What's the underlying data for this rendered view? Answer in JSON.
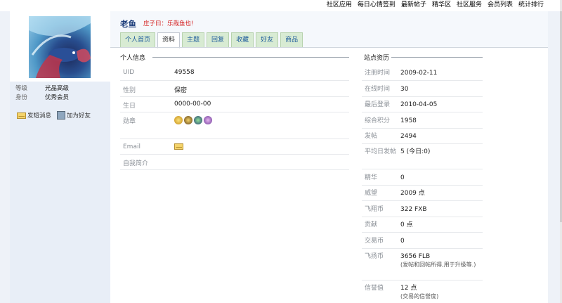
{
  "topnav": [
    "社区应用",
    "每日心情签到",
    "最新帖子",
    "精华区",
    "社区服务",
    "会员列表",
    "统计排行"
  ],
  "sidebar": {
    "info": [
      {
        "label": "等级",
        "value": "光晶高级"
      },
      {
        "label": "身份",
        "value": "优秀会员"
      }
    ],
    "actions": [
      {
        "icon": "mail-icon",
        "label": "发短消息"
      },
      {
        "icon": "user-add-icon",
        "label": "加为好友"
      }
    ]
  },
  "profile": {
    "username": "老鱼",
    "motto": "庄子曰：乐哉鱼也!",
    "tabs": [
      "个人首页",
      "资料",
      "主题",
      "回复",
      "收藏",
      "好友",
      "商品"
    ],
    "active_tab": "资料"
  },
  "personal": {
    "title": "个人信息",
    "uid_label": "UID",
    "uid": "49558",
    "gender_label": "性别",
    "gender": "保密",
    "birthday_label": "生日",
    "birthday": "0000-00-00",
    "medals_label": "勋章",
    "email_label": "Email",
    "intro_label": "自我简介"
  },
  "stats": {
    "title": "站点资历",
    "rows": [
      {
        "k": "注册时间",
        "v": "2009-02-11"
      },
      {
        "k": "在线时间",
        "v": "30"
      },
      {
        "k": "最后登录",
        "v": "2010-04-05"
      },
      {
        "k": "综合积分",
        "v": "1958"
      },
      {
        "k": "发帖",
        "v": "2494"
      },
      {
        "k": "平均日发帖",
        "v": "5 (今日:0)"
      },
      {
        "k": "精华",
        "v": "0"
      },
      {
        "k": "威望",
        "v": "2009 点"
      },
      {
        "k": "飞翔币",
        "v": "322 FXB"
      },
      {
        "k": "贡献",
        "v": "0 点"
      },
      {
        "k": "交易币",
        "v": "0"
      },
      {
        "k": "飞扬币",
        "v": "3656 FLB",
        "note": "(发帖和回帖所得,用于升级等.)"
      },
      {
        "k": "信誉值",
        "v": "12 点",
        "note": "(交易的信誉度)"
      }
    ]
  },
  "colors": {
    "accent": "#1b3c7a",
    "motto": "#d31b1b",
    "tab_bg": "#d8ebd3",
    "tab_text": "#1f5d9c"
  }
}
